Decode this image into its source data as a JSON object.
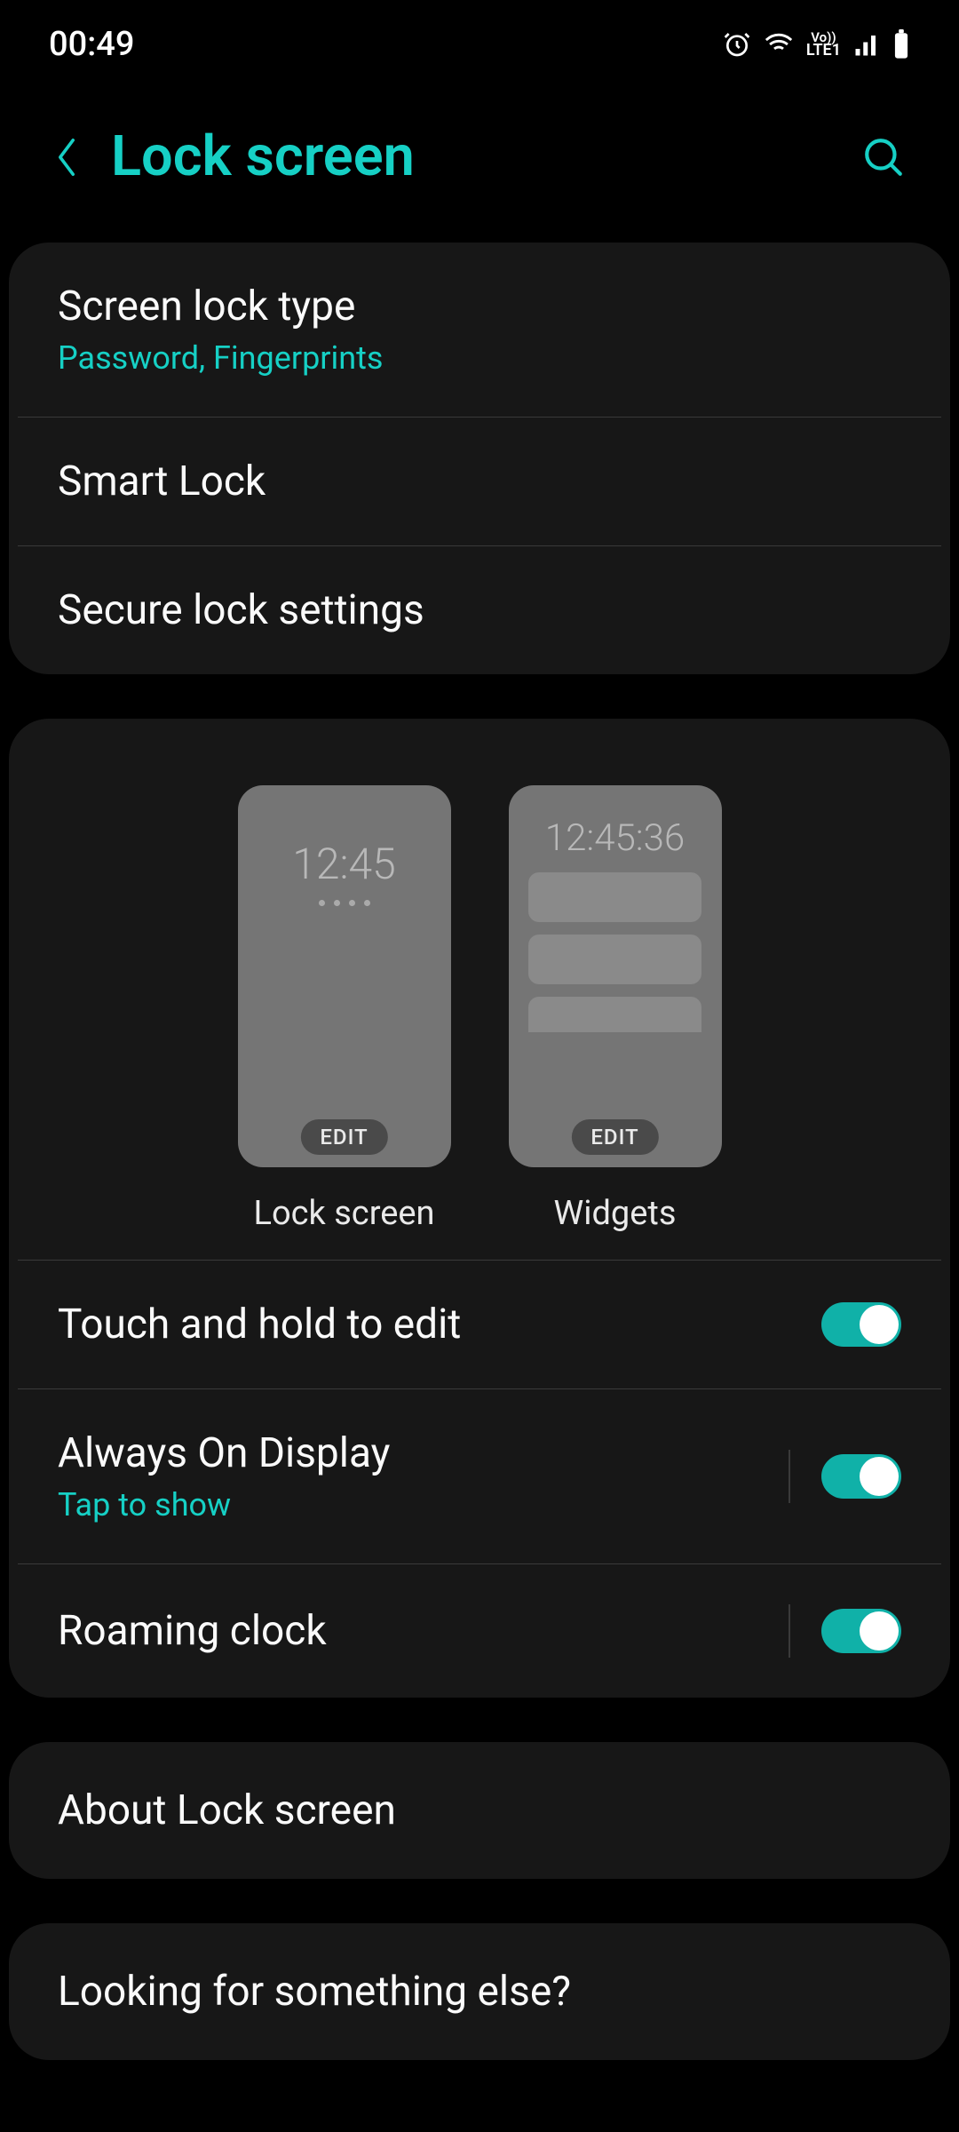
{
  "status": {
    "time": "00:49",
    "network_label": "LTE1",
    "vo_label": "Vo))"
  },
  "header": {
    "title": "Lock screen"
  },
  "group1": {
    "screen_lock_type": {
      "label": "Screen lock type",
      "sub": "Password, Fingerprints"
    },
    "smart_lock": {
      "label": "Smart Lock"
    },
    "secure_lock": {
      "label": "Secure lock settings"
    }
  },
  "previews": {
    "lockscreen": {
      "clock": "12:45",
      "edit": "EDIT",
      "caption": "Lock screen"
    },
    "widgets": {
      "clock": "12:45:36",
      "edit": "EDIT",
      "caption": "Widgets"
    }
  },
  "group2": {
    "touch_hold": {
      "label": "Touch and hold to edit",
      "on": true
    },
    "aod": {
      "label": "Always On Display",
      "sub": "Tap to show",
      "on": true
    },
    "roaming": {
      "label": "Roaming clock",
      "on": true
    }
  },
  "about": {
    "label": "About Lock screen"
  },
  "looking": {
    "label": "Looking for something else?"
  }
}
